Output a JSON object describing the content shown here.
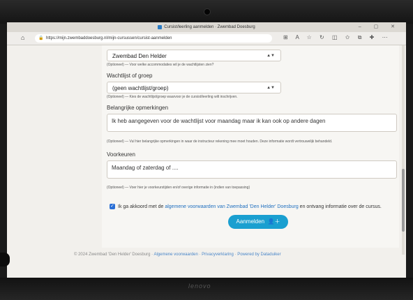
{
  "window": {
    "tab_title": "Cursist/leerling aanmelden · Zwembad Doesburg"
  },
  "browser": {
    "url": "https://mijn.zwembaddoesburg.nl/mijn-cursussen/cursist-aanmelden",
    "nav_icons": [
      "back-icon",
      "home-icon"
    ],
    "toolbar_icons": [
      "reader-icon",
      "read-aloud-icon",
      "favorite-icon",
      "refresh-icon",
      "split-icon",
      "favorites-icon",
      "collections-icon",
      "extensions-icon",
      "more-icon"
    ]
  },
  "form": {
    "accommodation": {
      "value": "Zwembad Den Helder",
      "help": "(Optioneel) — Voor welke accommodaties wil je de wachtlijsten zien?"
    },
    "waitlist": {
      "label": "Wachtlijst of groep",
      "value": "(geen wachtlijst/groep)",
      "help": "(Optioneel) — Kies de wachtlijst/groep waarvoor je de cursist/leerling wilt inschrijven."
    },
    "remarks": {
      "label": "Belangrijke opmerkingen",
      "value": "Ik heb aangegeven voor de wachtlijst voor maandag maar ik kan ook op andere dagen",
      "help": "(Optioneel) — Vul hier belangrijke opmerkingen in waar de instructeur rekening mee moet houden. Deze informatie wordt vertrouwelijk behandeld."
    },
    "preferences": {
      "label": "Voorkeuren",
      "value": "Maandag of zaterdag of ....",
      "help": "(Optioneel) — Voer hier je voorkeurstijden en/of overige informatie in (indien van toepassing)"
    },
    "agreement": {
      "checked": true,
      "prefix": "Ik ga akkoord met de",
      "link": "algemene voorwaarden van Zwembad 'Den Helder' Doesburg",
      "suffix": "en ontvang informatie over de cursus."
    },
    "submit_label": "Aanmelden"
  },
  "footer": {
    "copyright": "© 2024 Zwembad 'Den Helder' Doesburg ·",
    "links": [
      "Algemene voorwaarden",
      "Privacyverklaring",
      "Powered by Dataduiker"
    ]
  },
  "device": {
    "brand": "lenovo"
  },
  "colors": {
    "accent": "#1a9fd0",
    "link": "#1f6fbf",
    "checkbox": "#2a6fd6"
  }
}
